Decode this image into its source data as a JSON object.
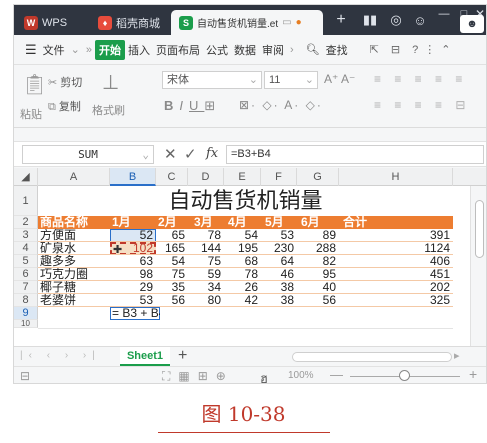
{
  "titlebar": {
    "tabs": [
      {
        "label": "WPS",
        "icon": "wps-logo-icon"
      },
      {
        "label": "稻壳商城",
        "icon": "docer-logo-icon"
      },
      {
        "label": "自动售货机销量.et",
        "icon": "spreadsheet-file-icon"
      }
    ],
    "colors": {
      "bar": "#2f3540",
      "wps": "#e74c3c",
      "docer": "#e74c3c",
      "et": "#1b9d4b"
    }
  },
  "menubar": {
    "items": [
      "文件",
      "开始",
      "插入",
      "页面布局",
      "公式",
      "数据",
      "审阅"
    ],
    "search_label": "查找"
  },
  "ribbon": {
    "paste_label": "粘贴",
    "cut_label": "剪切",
    "copy_label": "复制",
    "format_painter_label": "格式刷",
    "font_name": "宋体",
    "font_size": "11"
  },
  "formula_bar": {
    "name_box": "SUM",
    "fx_label": "fx",
    "formula": "=B3+B4"
  },
  "grid": {
    "columns": [
      "A",
      "B",
      "C",
      "D",
      "E",
      "F",
      "G",
      "H"
    ],
    "selected_column": "B",
    "rows": [
      "1",
      "2",
      "3",
      "4",
      "5",
      "6",
      "7",
      "8",
      "9",
      "10"
    ],
    "selected_row": "9",
    "title": "自动售货机销量",
    "headers": [
      "商品名称",
      "1月",
      "2月",
      "3月",
      "4月",
      "5月",
      "6月",
      "合计"
    ],
    "data": [
      [
        "方便面",
        "52",
        "65",
        "78",
        "54",
        "53",
        "89",
        "391"
      ],
      [
        "矿泉水",
        "102",
        "165",
        "144",
        "195",
        "230",
        "288",
        "1124"
      ],
      [
        "趣多多",
        "63",
        "54",
        "75",
        "68",
        "64",
        "82",
        "406"
      ],
      [
        "巧克力圈",
        "98",
        "75",
        "59",
        "78",
        "46",
        "95",
        "451"
      ],
      [
        "椰子糖",
        "29",
        "35",
        "34",
        "26",
        "38",
        "40",
        "202"
      ],
      [
        "老婆饼",
        "53",
        "56",
        "80",
        "42",
        "38",
        "56",
        "325"
      ]
    ],
    "editing_cell_text": "= B3 + B4",
    "header_color": "#ed7d31"
  },
  "sheetbar": {
    "sheet_tab": "Sheet1",
    "add_label": "+"
  },
  "statusbar": {
    "zoom": "100%"
  },
  "caption": "图 10-38"
}
